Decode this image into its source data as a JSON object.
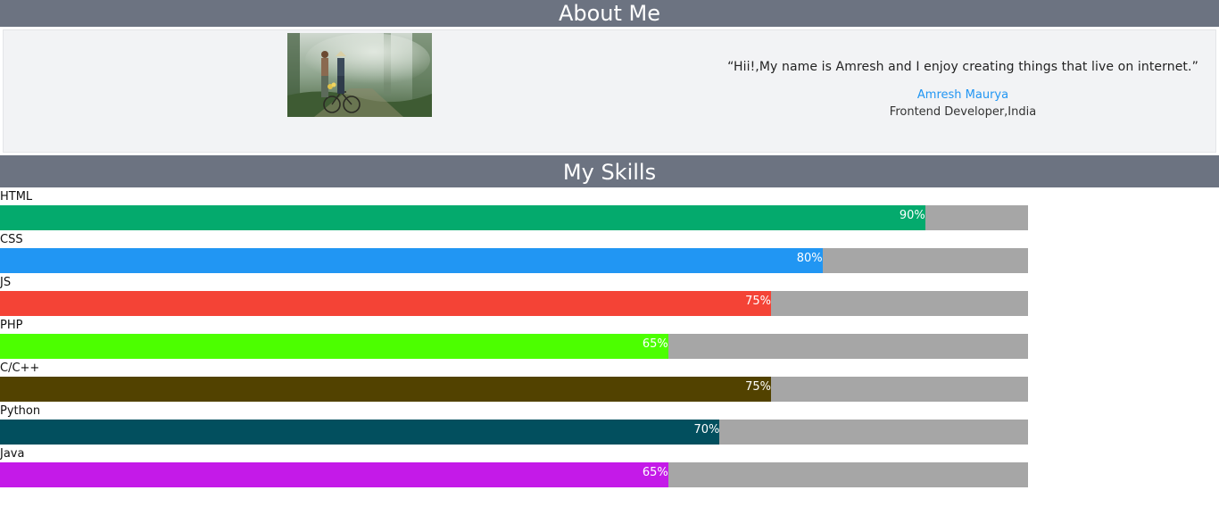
{
  "about": {
    "title": "About Me",
    "quote": "“Hii!,My name is Amresh and I enjoy creating things that live on internet.”",
    "name": "Amresh Maurya",
    "role": "Frontend Developer,India",
    "photo_alt": "Two people with a bicycle on a misty forest path"
  },
  "skills": {
    "title": "My Skills",
    "items": [
      {
        "label": "HTML",
        "value": 90,
        "text": "90%",
        "color": "#04aa6d"
      },
      {
        "label": "CSS",
        "value": 80,
        "text": "80%",
        "color": "#2196f3"
      },
      {
        "label": "JS",
        "value": 75,
        "text": "75%",
        "color": "#f44336"
      },
      {
        "label": "PHP",
        "value": 65,
        "text": "65%",
        "color": "#4cff00"
      },
      {
        "label": "C/C++",
        "value": 75,
        "text": "75%",
        "color": "#524200"
      },
      {
        "label": "Python",
        "value": 70,
        "text": "70%",
        "color": "#024f5e"
      },
      {
        "label": "Java",
        "value": 65,
        "text": "65%",
        "color": "#c41ae8"
      }
    ]
  },
  "colors": {
    "header_bg": "#6c7381",
    "track_bg": "#a6a6a6",
    "card_bg": "#f2f3f5",
    "accent": "#2196f3"
  }
}
